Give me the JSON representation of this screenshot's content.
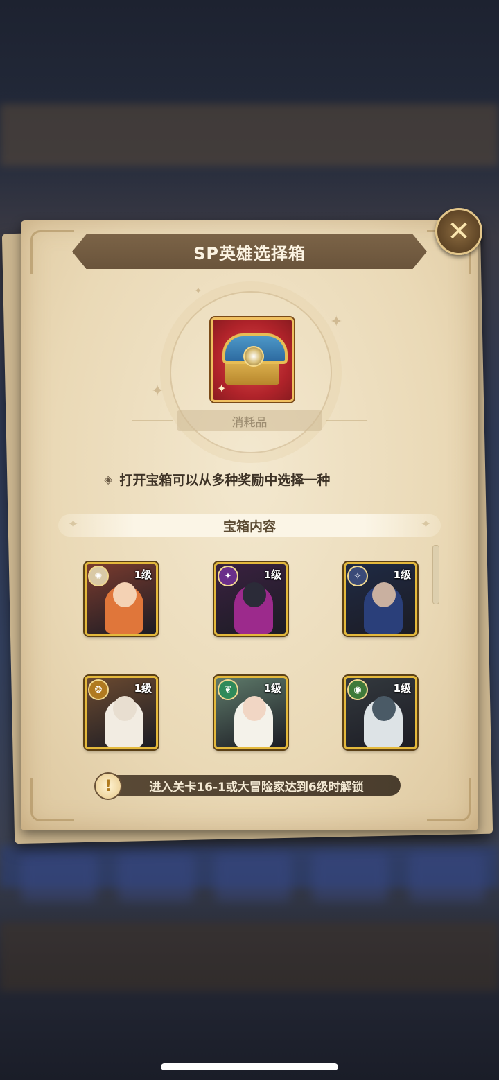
{
  "dialog": {
    "title": "SP英雄选择箱",
    "close_icon": "✕",
    "item_category": "消耗品",
    "description": "打开宝箱可以从多种奖励中选择一种",
    "section_title": "宝箱内容",
    "unlock_hint": "进入关卡16-1或大冒险家达到6级时解锁",
    "unlock_icon": "!"
  },
  "chest_icon": "treasure-chest-icon",
  "heroes": [
    {
      "level": "1级",
      "faction_icon": "sun-faction-icon",
      "faction_glyph": "✺",
      "faction_color": "#d9c9a6",
      "art_bg": "#7a3b2e",
      "hair": "#e0763a",
      "face": "#f4d2b4"
    },
    {
      "level": "1级",
      "faction_icon": "void-faction-icon",
      "faction_glyph": "✦",
      "faction_color": "#6a2f8a",
      "art_bg": "#3a2140",
      "hair": "#9c2a8c",
      "face": "#2b2b38"
    },
    {
      "level": "1级",
      "faction_icon": "star-faction-icon",
      "faction_glyph": "✧",
      "faction_color": "#3a4a78",
      "art_bg": "#1f2a44",
      "hair": "#2a3f7a",
      "face": "#c9b0a0"
    },
    {
      "level": "1级",
      "faction_icon": "wheel-faction-icon",
      "faction_glyph": "❂",
      "faction_color": "#b07a20",
      "art_bg": "#6b4a30",
      "hair": "#f2ece2",
      "face": "#e8ded0"
    },
    {
      "level": "1级",
      "faction_icon": "leaf-faction-icon",
      "faction_glyph": "❦",
      "faction_color": "#2f8a5a",
      "art_bg": "#5e7a6a",
      "hair": "#f4f2ea",
      "face": "#f1d6c4"
    },
    {
      "level": "1级",
      "faction_icon": "eye-faction-icon",
      "faction_glyph": "◉",
      "faction_color": "#3f7a3a",
      "art_bg": "#33393e",
      "hair": "#dde3e6",
      "face": "#4a5a66"
    }
  ]
}
